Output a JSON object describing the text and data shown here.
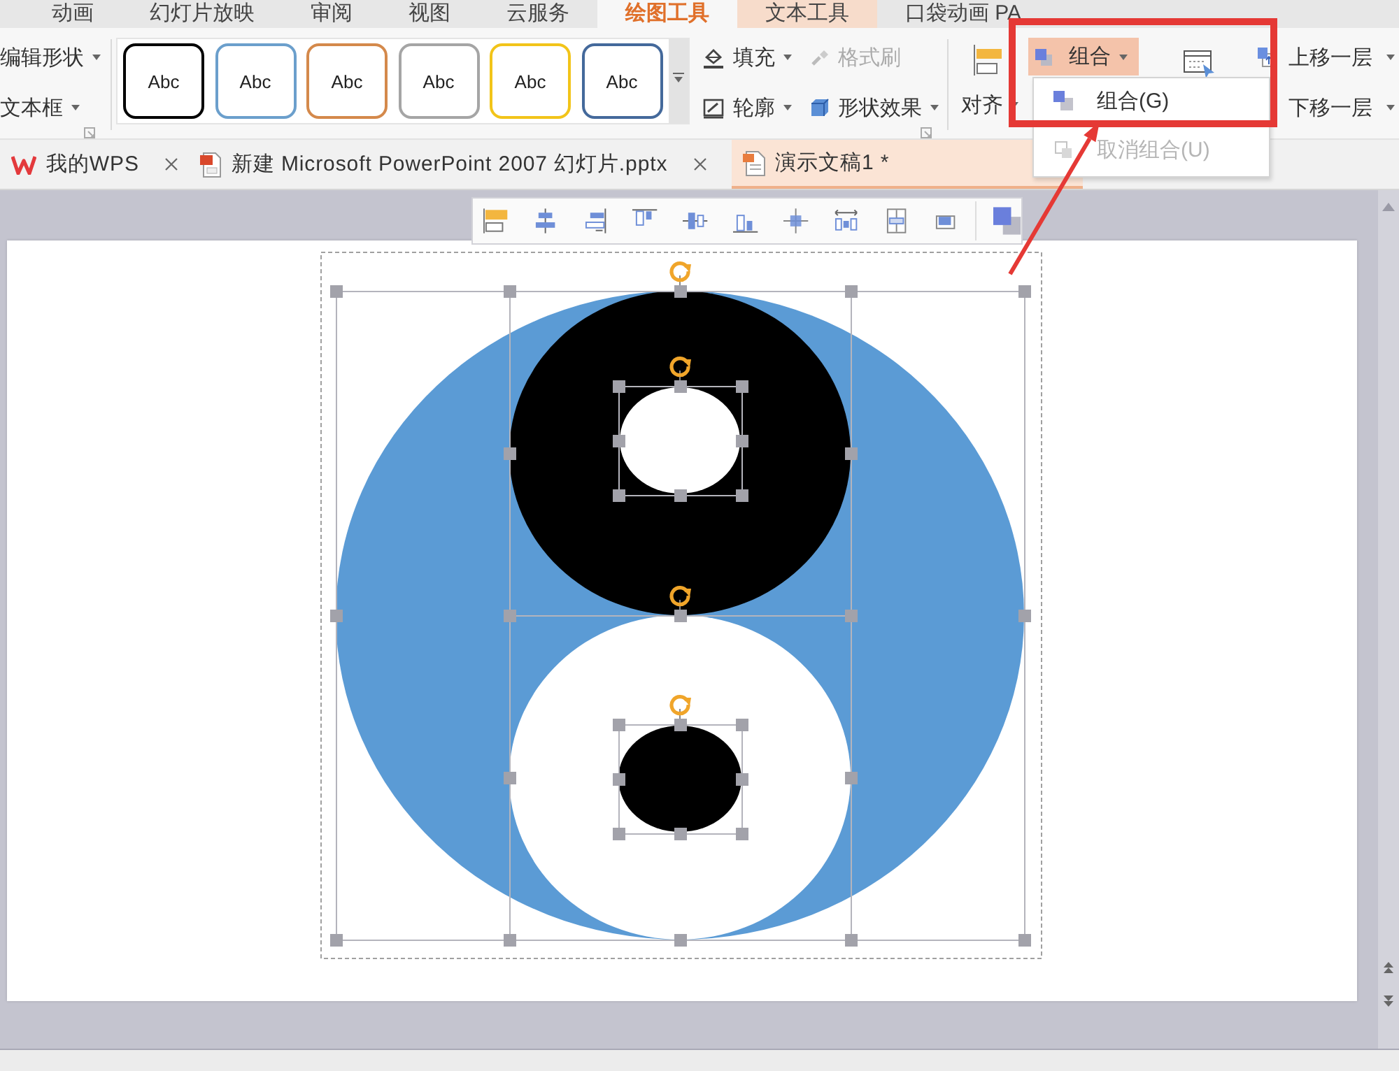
{
  "ribbon_tabs": [
    {
      "label": "动画",
      "kind": "standard",
      "selected": false
    },
    {
      "label": "幻灯片放映",
      "kind": "standard",
      "selected": false
    },
    {
      "label": "审阅",
      "kind": "standard",
      "selected": false
    },
    {
      "label": "视图",
      "kind": "standard",
      "selected": false
    },
    {
      "label": "云服务",
      "kind": "standard",
      "selected": false
    },
    {
      "label": "绘图工具",
      "kind": "contextual",
      "selected": true
    },
    {
      "label": "文本工具",
      "kind": "contextual",
      "selected": false
    },
    {
      "label": "口袋动画 PA",
      "kind": "standard",
      "selected": false
    }
  ],
  "ribbon": {
    "shape_buttons": [
      {
        "label": "编辑形状",
        "dropdown": true
      },
      {
        "label": "文本框",
        "dropdown": true
      }
    ],
    "style_gallery": [
      {
        "label": "Abc",
        "color": "#000000"
      },
      {
        "label": "Abc",
        "color": "#6b9fcc"
      },
      {
        "label": "Abc",
        "color": "#d4894b"
      },
      {
        "label": "Abc",
        "color": "#a5a5a5"
      },
      {
        "label": "Abc",
        "color": "#f2c419"
      },
      {
        "label": "Abc",
        "color": "#44699b"
      }
    ],
    "format_buttons": [
      {
        "label": "填充",
        "dropdown": true,
        "disabled": false
      },
      {
        "label": "格式刷",
        "dropdown": false,
        "disabled": true
      },
      {
        "label": "轮廓",
        "dropdown": true,
        "disabled": false
      },
      {
        "label": "形状效果",
        "dropdown": true,
        "disabled": false
      }
    ],
    "align_button": {
      "label": "对齐",
      "dropdown": true
    },
    "group_button": {
      "label": "组合",
      "dropdown": true,
      "expanded": true
    },
    "bring_forward": {
      "label": "上移一层",
      "dropdown": true
    },
    "send_backward": {
      "label": "下移一层",
      "dropdown": true
    }
  },
  "group_menu": [
    {
      "label": "组合(G)",
      "disabled": false
    },
    {
      "label": "取消组合(U)",
      "disabled": true
    }
  ],
  "document_tabs": [
    {
      "label": "我的WPS",
      "kind": "home",
      "selected": false
    },
    {
      "label": "新建 Microsoft PowerPoint 2007 幻灯片.pptx",
      "kind": "presentation",
      "selected": false
    },
    {
      "label": "演示文稿1 *",
      "kind": "draft",
      "selected": true
    }
  ]
}
